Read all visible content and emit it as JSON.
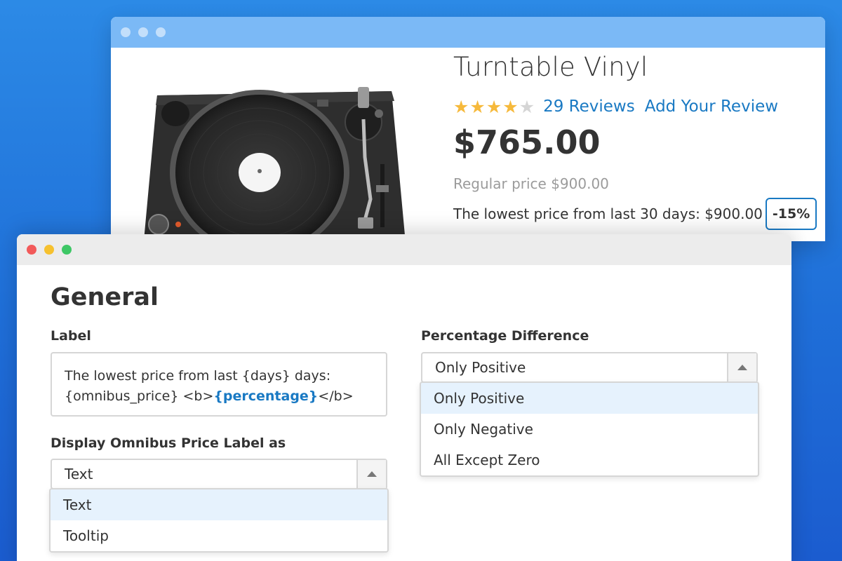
{
  "product_page": {
    "title": "Turntable Vinyl",
    "rating": {
      "stars_filled": 4,
      "stars_total": 5
    },
    "reviews_link": "29 Reviews",
    "add_review_link": "Add Your Review",
    "price": "$765.00",
    "regular_price": "Regular price $900.00",
    "lowest_price": "The lowest price from last 30 days: $900.00",
    "discount_badge": "-15%"
  },
  "settings": {
    "section_title": "General",
    "label_field": {
      "label": "Label",
      "value_part1": "The lowest price from last {days} days: {omnibus_price} <b>",
      "value_highlight": "{percentage}",
      "value_part2": "</b>"
    },
    "display_as": {
      "label": "Display Omnibus Price Label as",
      "selected": "Text",
      "options": [
        "Text",
        "Tooltip"
      ]
    },
    "percentage_difference": {
      "label": "Percentage Difference",
      "selected": "Only Positive",
      "options": [
        "Only Positive",
        "Only Negative",
        "All Except Zero"
      ]
    }
  },
  "colors": {
    "accent": "#1979c3",
    "star": "#f6b93b",
    "selected_option_bg": "#e6f2fd"
  }
}
